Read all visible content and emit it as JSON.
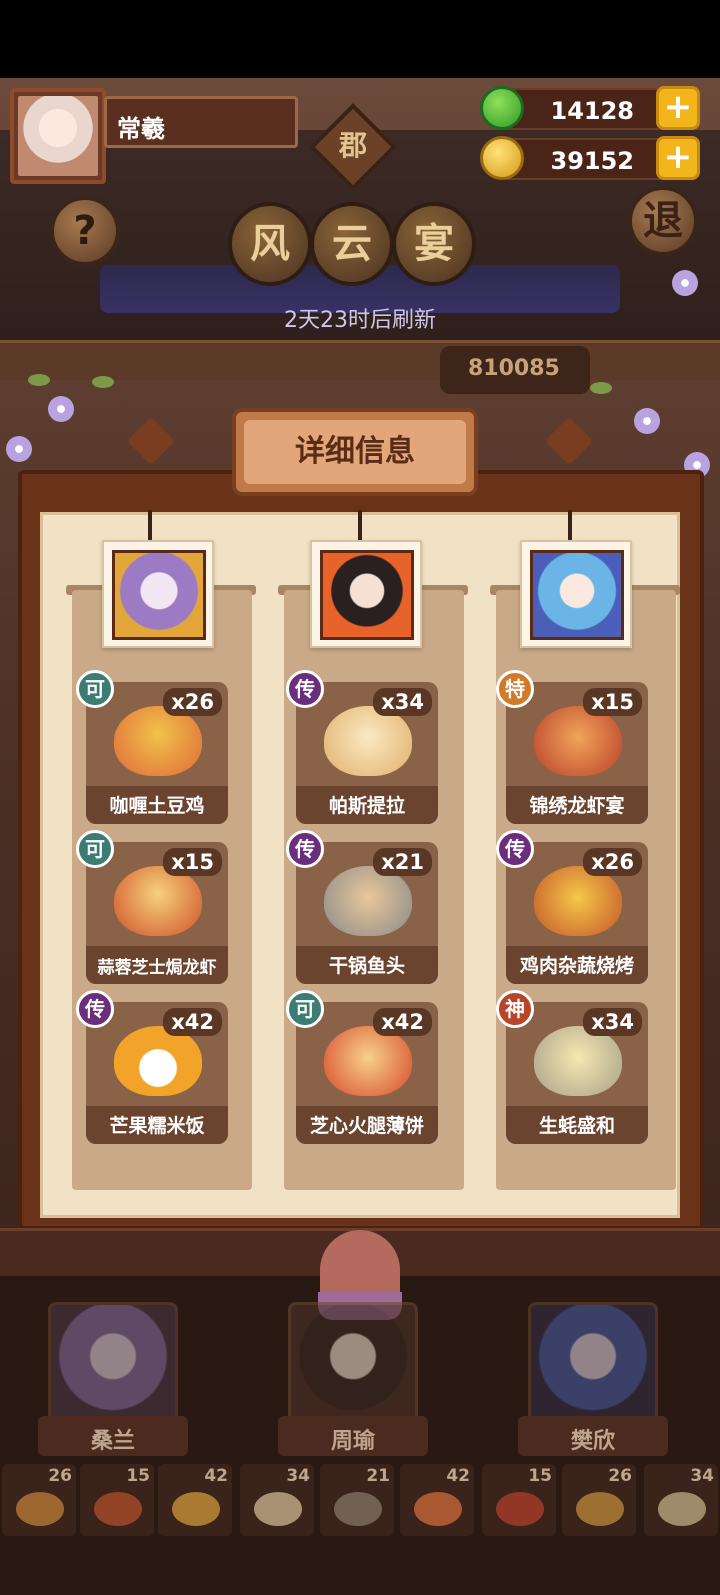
{
  "player": {
    "name": "常羲"
  },
  "currency": {
    "jade": {
      "value": "14128",
      "icon": "jade-coin-icon"
    },
    "gold": {
      "value": "39152",
      "icon": "gold-coin-icon"
    }
  },
  "header": {
    "region_char": "郡",
    "title_chars": [
      "风",
      "云",
      "宴"
    ],
    "help_label": "?",
    "exit_label": "退",
    "refresh_text": "2天23时后刷新",
    "score_text": "810085"
  },
  "panel": {
    "title": "详细信息",
    "columns": [
      {
        "chef": "桑兰",
        "dishes": [
          {
            "name": "咖喱土豆鸡",
            "count": "x26",
            "rarity": "可"
          },
          {
            "name": "蒜蓉芝士焗龙虾",
            "count": "x15",
            "rarity": "可"
          },
          {
            "name": "芒果糯米饭",
            "count": "x42",
            "rarity": "传"
          }
        ]
      },
      {
        "chef": "周瑜",
        "dishes": [
          {
            "name": "帕斯提拉",
            "count": "x34",
            "rarity": "传"
          },
          {
            "name": "干锅鱼头",
            "count": "x21",
            "rarity": "传"
          },
          {
            "name": "芝心火腿薄饼",
            "count": "x42",
            "rarity": "可"
          }
        ]
      },
      {
        "chef": "樊欣",
        "dishes": [
          {
            "name": "锦绣龙虾宴",
            "count": "x15",
            "rarity": "特"
          },
          {
            "name": "鸡肉杂蔬烧烤",
            "count": "x26",
            "rarity": "传"
          },
          {
            "name": "生蚝盛和",
            "count": "x34",
            "rarity": "神"
          }
        ]
      }
    ]
  },
  "chefs": [
    {
      "name": "桑兰"
    },
    {
      "name": "周瑜"
    },
    {
      "name": "樊欣"
    }
  ],
  "tray_counts": [
    "26",
    "15",
    "42",
    "34",
    "21",
    "42",
    "15",
    "26",
    "34"
  ],
  "colors": {
    "badge_ke": "#3c7c73",
    "badge_chuan": "#6a2e7c",
    "badge_te": "#d07a2a",
    "badge_shen": "#b6452a",
    "plus": "#f2b51c"
  }
}
